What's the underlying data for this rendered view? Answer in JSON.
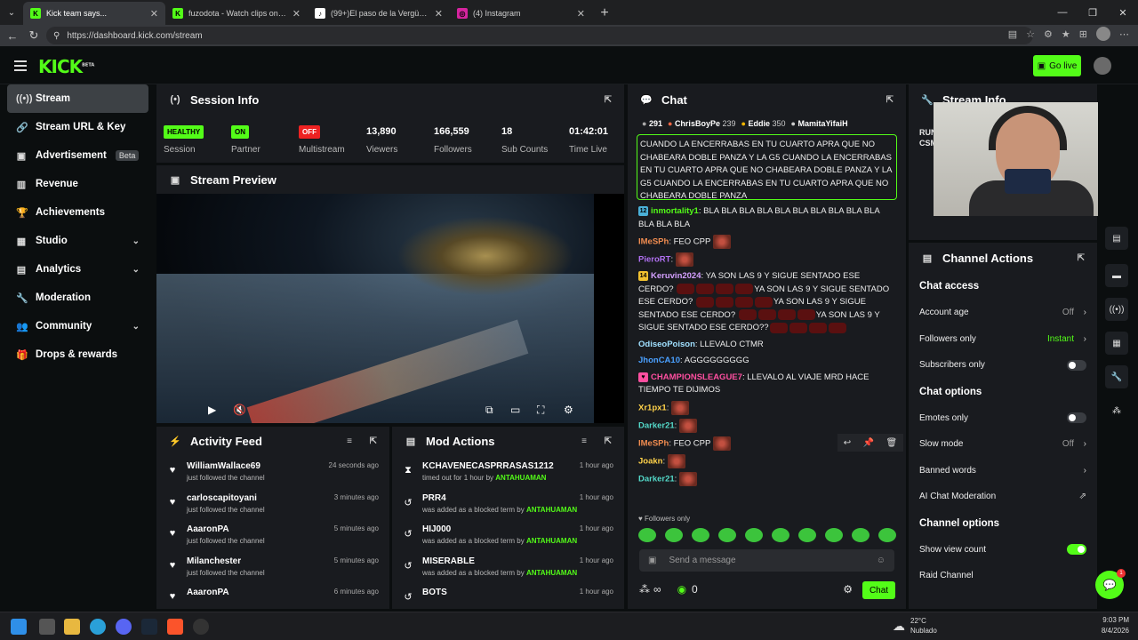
{
  "browser": {
    "tabs": [
      {
        "title": "Kick team says...",
        "color": "#53fc18",
        "icon": "K"
      },
      {
        "title": "fuzodota - Watch clips on Kick",
        "color": "#53fc18",
        "icon": "K"
      },
      {
        "title": "(99+)El paso de la Vergüenza #sha",
        "color": "#ffffff",
        "icon": "♪"
      },
      {
        "title": "(4) Instagram",
        "color": "#d6249f",
        "icon": "◎"
      }
    ],
    "url": "https://dashboard.kick.com/stream"
  },
  "header": {
    "logo": "KICK",
    "logo_sup": "BETA",
    "go_live": "Go live"
  },
  "sidebar": {
    "items": [
      {
        "label": "Stream",
        "icon": "signal-icon",
        "glyph": "((•))",
        "active": true
      },
      {
        "label": "Stream URL & Key",
        "icon": "link-icon",
        "glyph": "🔗"
      },
      {
        "label": "Advertisement",
        "icon": "megaphone-icon",
        "glyph": "▣",
        "badge": "Beta"
      },
      {
        "label": "Revenue",
        "icon": "chart-icon",
        "glyph": "▥"
      },
      {
        "label": "Achievements",
        "icon": "trophy-icon",
        "glyph": "🏆"
      },
      {
        "label": "Studio",
        "icon": "studio-icon",
        "glyph": "▦",
        "chevron": true
      },
      {
        "label": "Analytics",
        "icon": "analytics-icon",
        "glyph": "▤",
        "chevron": true
      },
      {
        "label": "Moderation",
        "icon": "wrench-icon",
        "glyph": "🔧"
      },
      {
        "label": "Community",
        "icon": "users-icon",
        "glyph": "👥",
        "chevron": true
      },
      {
        "label": "Drops & rewards",
        "icon": "gift-icon",
        "glyph": "🎁"
      }
    ]
  },
  "session": {
    "title": "Session Info",
    "health": "HEALTHY",
    "health_label": "Session",
    "partner": "ON",
    "partner_label": "Partner",
    "multistream": "OFF",
    "multistream_label": "Multistream",
    "viewers": "13,890",
    "viewers_label": "Viewers",
    "followers": "166,559",
    "followers_label": "Followers",
    "subs": "18",
    "subs_label": "Sub Counts",
    "time": "01:42:01",
    "time_label": "Time Live"
  },
  "preview": {
    "title": "Stream Preview"
  },
  "activity": {
    "title": "Activity Feed",
    "rows": [
      {
        "name": "WilliamWallace69",
        "sub": "just followed the channel",
        "time": "24 seconds ago"
      },
      {
        "name": "carloscapitoyani",
        "sub": "just followed the channel",
        "time": "3 minutes ago"
      },
      {
        "name": "AaaronPA",
        "sub": "just followed the channel",
        "time": "5 minutes ago"
      },
      {
        "name": "Milanchester",
        "sub": "just followed the channel",
        "time": "5 minutes ago"
      },
      {
        "name": "AaaronPA",
        "sub": "",
        "time": "6 minutes ago"
      }
    ]
  },
  "mod": {
    "title": "Mod Actions",
    "rows": [
      {
        "name": "KCHAVENECASPRRASAS1212",
        "sub": "timed out for 1 hour by ",
        "by": "ANTAHUAMAN",
        "time": "1 hour ago",
        "icon": "hourglass-icon",
        "glyph": "⧗"
      },
      {
        "name": "PRR4",
        "sub": "was added as a blocked term by ",
        "by": "ANTAHUAMAN",
        "time": "1 hour ago",
        "icon": "undo-icon",
        "glyph": "↺"
      },
      {
        "name": "HIJ000",
        "sub": "was added as a blocked term by ",
        "by": "ANTAHUAMAN",
        "time": "1 hour ago",
        "icon": "undo-icon",
        "glyph": "↺"
      },
      {
        "name": "MISERABLE",
        "sub": "was added as a blocked term by ",
        "by": "ANTAHUAMAN",
        "time": "1 hour ago",
        "icon": "undo-icon",
        "glyph": "↺"
      },
      {
        "name": "BOTS",
        "sub": "",
        "by": "",
        "time": "1 hour ago",
        "icon": "undo-icon",
        "glyph": "↺"
      }
    ]
  },
  "chat": {
    "title": "Chat",
    "top": [
      {
        "name": "291",
        "pts": ""
      },
      {
        "name": "ChrisBoyPe",
        "pts": "239"
      },
      {
        "name": "Eddie",
        "pts": "350"
      },
      {
        "name": "MamitaYifaiH",
        "pts": ""
      }
    ],
    "pinned": "CUANDO LA ENCERRABAS EN TU CUARTO APRA QUE NO CHABEARA DOBLE PANZA Y LA G5 CUANDO LA ENCERRABAS EN TU CUARTO APRA QUE NO CHABEARA DOBLE PANZA Y LA G5 CUANDO LA ENCERRABAS EN TU CUARTO APRA QUE NO CHABEARA DOBLE PANZA",
    "messages": [
      {
        "user": "inmortality1",
        "color": "#53fc18",
        "badge": "12",
        "text": "BLA BLA BLA BLA BLA BLA BLA BLA BLA BLA BLA BLA BLA"
      },
      {
        "user": "IMeSPh",
        "color": "#f08c50",
        "text": "FEO CPP",
        "emote": true
      },
      {
        "user": "PieroRT",
        "color": "#b070f0",
        "text": "",
        "emote": true
      },
      {
        "user": "Keruvin2024",
        "color": "#d4a0ff",
        "badge": "14",
        "text": "YA SON LAS 9 Y SIGUE SENTADO ESE CERDO? YA SON LAS 9 Y SIGUE SENTADO ESE CERDO? YA SON LAS 9 Y SIGUE SENTADO ESE CERDO? YA SON LAS 9 Y SIGUE SENTADO ESE CERDO?"
      },
      {
        "user": "OdiseoPoison",
        "color": "#a0e0ff",
        "text": "LLEVALO CTMR"
      },
      {
        "user": "JhonCA10",
        "color": "#4aa0ff",
        "text": "AGGGGGGGGG"
      },
      {
        "user": "CHAMPIONSLEAGUE7",
        "color": "#ff4fa0",
        "text": "LLEVALO AL VIAJE MRD HACE TIEMPO TE DIJIMOS"
      },
      {
        "user": "Xr1px1",
        "color": "#ffd24a",
        "text": "",
        "emote": true
      },
      {
        "user": "Darker21",
        "color": "#53d8c8",
        "text": "",
        "emote": true
      },
      {
        "user": "IMeSPh",
        "color": "#f08c50",
        "text": "FEO CPP",
        "emote": true
      },
      {
        "user": "Joakn",
        "color": "#ffd24a",
        "text": "",
        "emote": true
      },
      {
        "user": "Darker21",
        "color": "#53d8c8",
        "text": "",
        "emote": true
      }
    ],
    "mode": "Followers only",
    "placeholder": "Send a message",
    "viewers_inf": "∞",
    "points": "0",
    "send": "Chat"
  },
  "stream_info": {
    "title": "Stream Info",
    "partial": "RUN CSM"
  },
  "channel_actions": {
    "title": "Channel Actions",
    "chat_access": "Chat access",
    "account_age": "Account age",
    "account_age_val": "Off",
    "followers_only": "Followers only",
    "followers_only_val": "Instant",
    "subs_only": "Subscribers only",
    "chat_options": "Chat options",
    "emotes_only": "Emotes only",
    "slow_mode": "Slow mode",
    "slow_mode_val": "Off",
    "banned_words": "Banned words",
    "ai_mod": "AI Chat Moderation",
    "channel_options": "Channel options",
    "show_view": "Show view count",
    "raid": "Raid Channel"
  },
  "taskbar": {
    "weather_temp": "22°C",
    "weather_desc": "Nublado",
    "time": "9:03 PM",
    "date": "8/4/2026"
  },
  "float": {
    "count": "1"
  }
}
